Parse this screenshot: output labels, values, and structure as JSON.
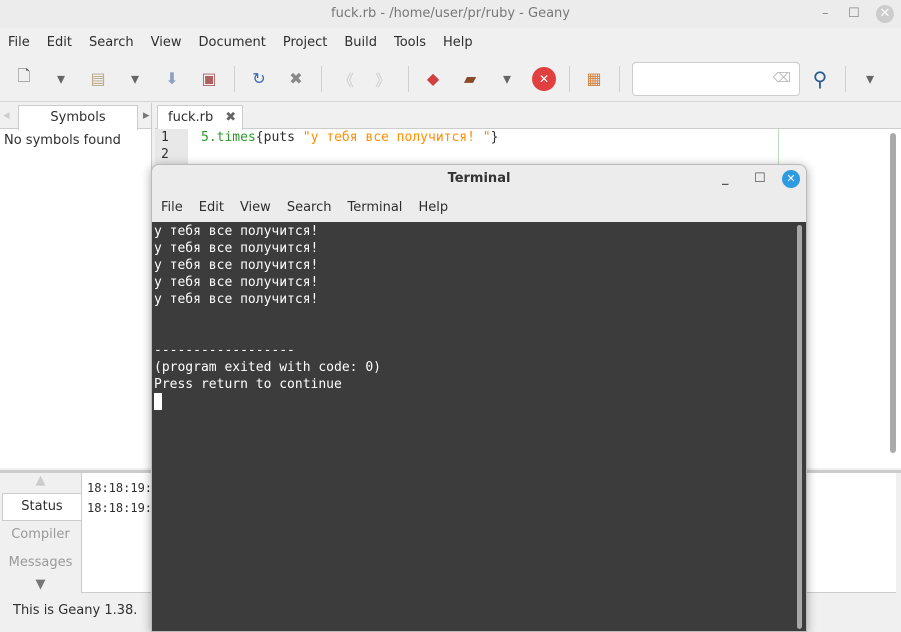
{
  "window": {
    "title": "fuck.rb - /home/user/pr/ruby - Geany"
  },
  "menu": [
    "File",
    "Edit",
    "Search",
    "View",
    "Document",
    "Project",
    "Build",
    "Tools",
    "Help"
  ],
  "sidebar": {
    "tab": "Symbols",
    "empty": "No symbols found"
  },
  "editor": {
    "tab": "fuck.rb",
    "lines": [
      "1",
      "2"
    ],
    "code": {
      "num": "5",
      "method": ".times",
      "brace_open": "{",
      "kw": "puts ",
      "string": "\"у тебя все получится! \"",
      "brace_close": "}"
    }
  },
  "messages": {
    "tabs": [
      "Status",
      "Compiler",
      "Messages"
    ],
    "lines": [
      "18:18:19:",
      "18:18:19:"
    ]
  },
  "statusbar": "This is Geany 1.38.",
  "terminal": {
    "title": "Terminal",
    "menu": [
      "File",
      "Edit",
      "View",
      "Search",
      "Terminal",
      "Help"
    ],
    "output": [
      "у тебя все получится!",
      "у тебя все получится!",
      "у тебя все получится!",
      "у тебя все получится!",
      "у тебя все получится!",
      "",
      "",
      "------------------",
      "(program exited with code: 0)",
      "Press return to continue"
    ]
  }
}
